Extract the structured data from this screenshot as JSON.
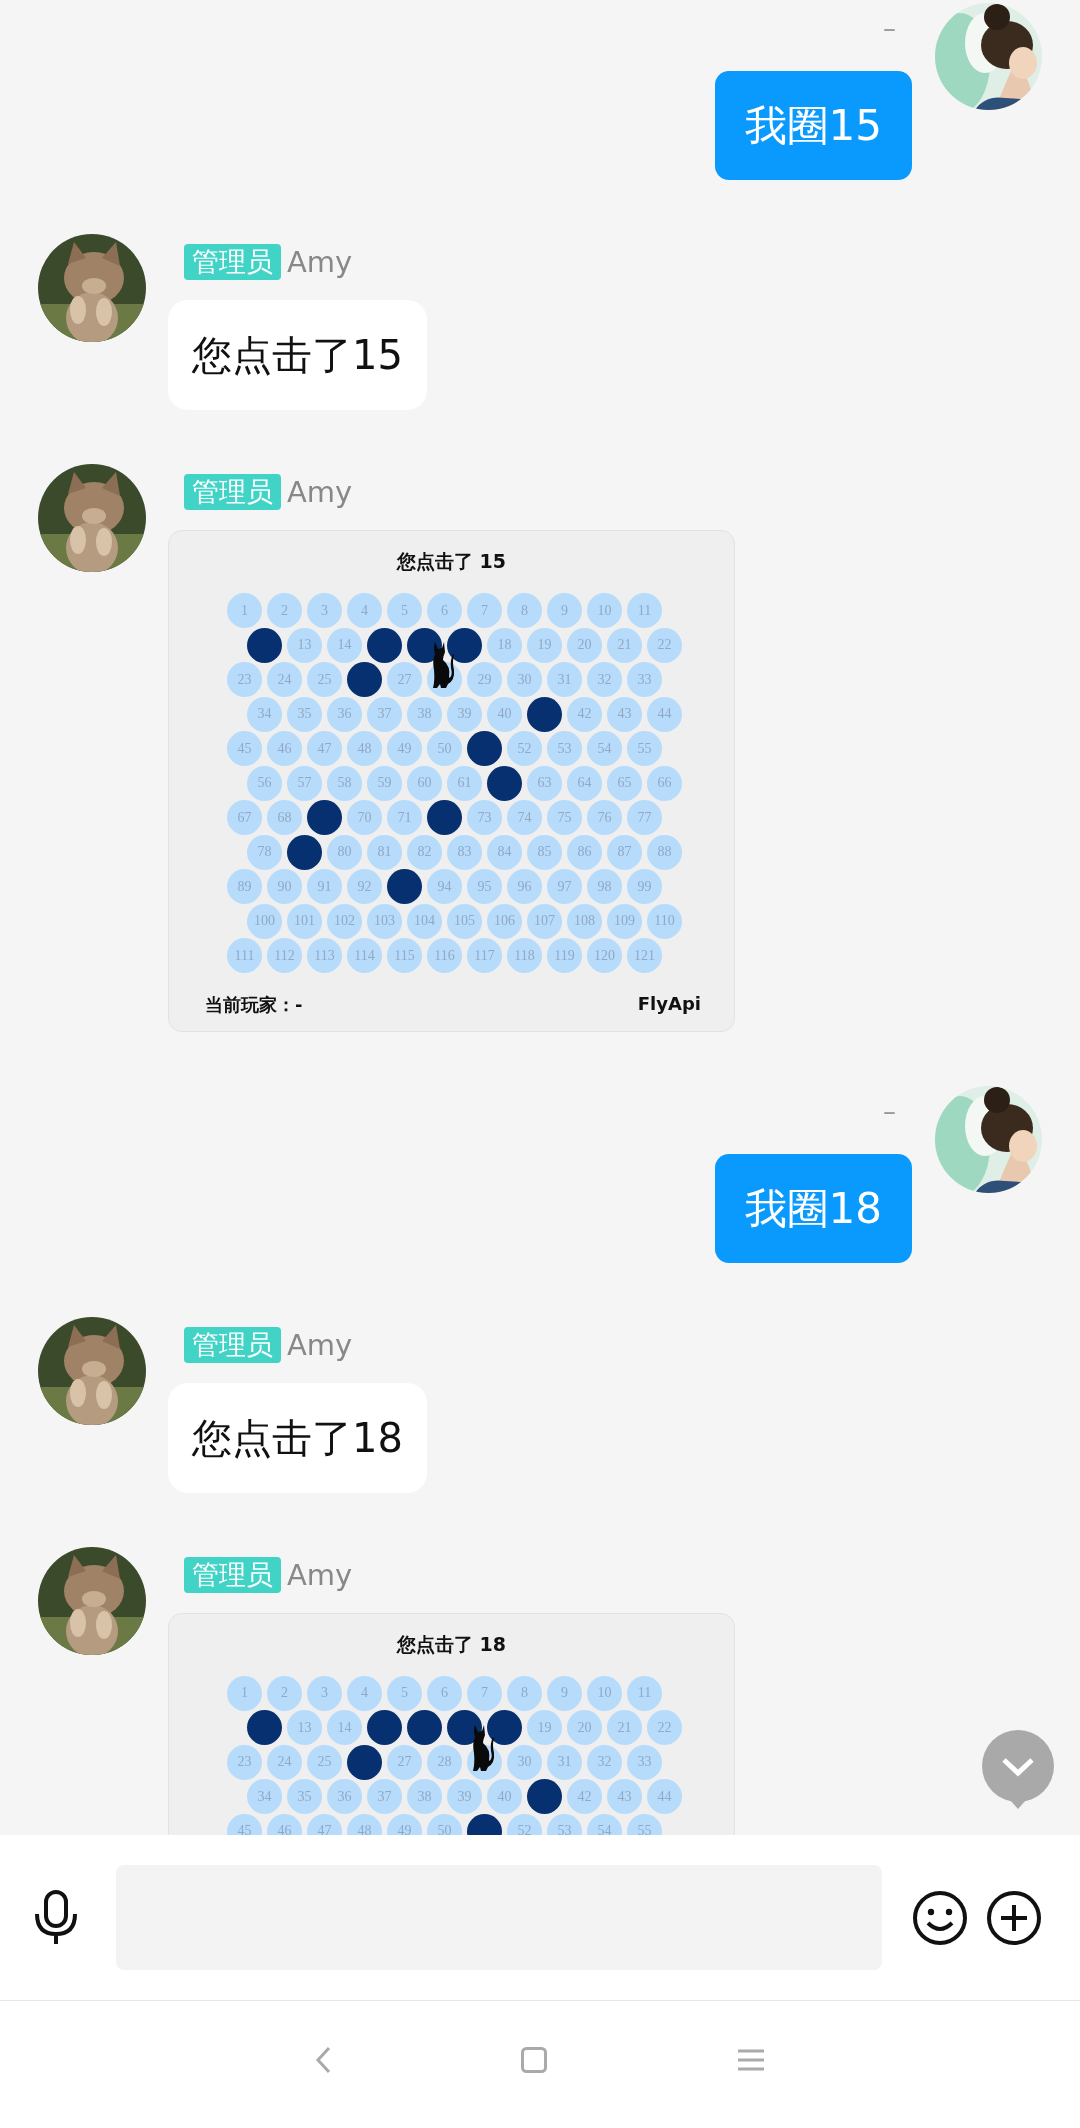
{
  "messages": [
    {
      "kind": "sent",
      "status": "–",
      "text": "我圈15"
    },
    {
      "kind": "text",
      "badge": "管理员",
      "sender": "Amy",
      "text": "您点击了15"
    },
    {
      "kind": "board",
      "badge": "管理员",
      "sender": "Amy",
      "board": {
        "title": "您点击了 15",
        "player": "当前玩家：-",
        "brand": "FlyApi",
        "cells": [
          {
            "label": "1",
            "blocked": false,
            "cat": false
          },
          {
            "label": "2",
            "blocked": false,
            "cat": false
          },
          {
            "label": "3",
            "blocked": false,
            "cat": false
          },
          {
            "label": "4",
            "blocked": false,
            "cat": false
          },
          {
            "label": "5",
            "blocked": false,
            "cat": false
          },
          {
            "label": "6",
            "blocked": false,
            "cat": false
          },
          {
            "label": "7",
            "blocked": false,
            "cat": false
          },
          {
            "label": "8",
            "blocked": false,
            "cat": false
          },
          {
            "label": "9",
            "blocked": false,
            "cat": false
          },
          {
            "label": "10",
            "blocked": false,
            "cat": false
          },
          {
            "label": "11",
            "blocked": false,
            "cat": false
          },
          {
            "blocked": true,
            "cat": false
          },
          {
            "label": "13",
            "blocked": false,
            "cat": false
          },
          {
            "label": "14",
            "blocked": false,
            "cat": false
          },
          {
            "blocked": true,
            "cat": false
          },
          {
            "blocked": true,
            "cat": false
          },
          {
            "blocked": true,
            "cat": false
          },
          {
            "label": "18",
            "blocked": false,
            "cat": false
          },
          {
            "label": "19",
            "blocked": false,
            "cat": false
          },
          {
            "label": "20",
            "blocked": false,
            "cat": false
          },
          {
            "label": "21",
            "blocked": false,
            "cat": false
          },
          {
            "label": "22",
            "blocked": false,
            "cat": false
          },
          {
            "label": "23",
            "blocked": false,
            "cat": false
          },
          {
            "label": "24",
            "blocked": false,
            "cat": false
          },
          {
            "label": "25",
            "blocked": false,
            "cat": false
          },
          {
            "blocked": true,
            "cat": false
          },
          {
            "label": "27",
            "blocked": false,
            "cat": false
          },
          {
            "blocked": false,
            "cat": true
          },
          {
            "label": "29",
            "blocked": false,
            "cat": false
          },
          {
            "label": "30",
            "blocked": false,
            "cat": false
          },
          {
            "label": "31",
            "blocked": false,
            "cat": false
          },
          {
            "label": "32",
            "blocked": false,
            "cat": false
          },
          {
            "label": "33",
            "blocked": false,
            "cat": false
          },
          {
            "label": "34",
            "blocked": false,
            "cat": false
          },
          {
            "label": "35",
            "blocked": false,
            "cat": false
          },
          {
            "label": "36",
            "blocked": false,
            "cat": false
          },
          {
            "label": "37",
            "blocked": false,
            "cat": false
          },
          {
            "label": "38",
            "blocked": false,
            "cat": false
          },
          {
            "label": "39",
            "blocked": false,
            "cat": false
          },
          {
            "label": "40",
            "blocked": false,
            "cat": false
          },
          {
            "blocked": true,
            "cat": false
          },
          {
            "label": "42",
            "blocked": false,
            "cat": false
          },
          {
            "label": "43",
            "blocked": false,
            "cat": false
          },
          {
            "label": "44",
            "blocked": false,
            "cat": false
          },
          {
            "label": "45",
            "blocked": false,
            "cat": false
          },
          {
            "label": "46",
            "blocked": false,
            "cat": false
          },
          {
            "label": "47",
            "blocked": false,
            "cat": false
          },
          {
            "label": "48",
            "blocked": false,
            "cat": false
          },
          {
            "label": "49",
            "blocked": false,
            "cat": false
          },
          {
            "label": "50",
            "blocked": false,
            "cat": false
          },
          {
            "blocked": true,
            "cat": false
          },
          {
            "label": "52",
            "blocked": false,
            "cat": false
          },
          {
            "label": "53",
            "blocked": false,
            "cat": false
          },
          {
            "label": "54",
            "blocked": false,
            "cat": false
          },
          {
            "label": "55",
            "blocked": false,
            "cat": false
          },
          {
            "label": "56",
            "blocked": false,
            "cat": false
          },
          {
            "label": "57",
            "blocked": false,
            "cat": false
          },
          {
            "label": "58",
            "blocked": false,
            "cat": false
          },
          {
            "label": "59",
            "blocked": false,
            "cat": false
          },
          {
            "label": "60",
            "blocked": false,
            "cat": false
          },
          {
            "label": "61",
            "blocked": false,
            "cat": false
          },
          {
            "blocked": true,
            "cat": false
          },
          {
            "label": "63",
            "blocked": false,
            "cat": false
          },
          {
            "label": "64",
            "blocked": false,
            "cat": false
          },
          {
            "label": "65",
            "blocked": false,
            "cat": false
          },
          {
            "label": "66",
            "blocked": false,
            "cat": false
          },
          {
            "label": "67",
            "blocked": false,
            "cat": false
          },
          {
            "label": "68",
            "blocked": false,
            "cat": false
          },
          {
            "blocked": true,
            "cat": false
          },
          {
            "label": "70",
            "blocked": false,
            "cat": false
          },
          {
            "label": "71",
            "blocked": false,
            "cat": false
          },
          {
            "blocked": true,
            "cat": false
          },
          {
            "label": "73",
            "blocked": false,
            "cat": false
          },
          {
            "label": "74",
            "blocked": false,
            "cat": false
          },
          {
            "label": "75",
            "blocked": false,
            "cat": false
          },
          {
            "label": "76",
            "blocked": false,
            "cat": false
          },
          {
            "label": "77",
            "blocked": false,
            "cat": false
          },
          {
            "label": "78",
            "blocked": false,
            "cat": false
          },
          {
            "blocked": true,
            "cat": false
          },
          {
            "label": "80",
            "blocked": false,
            "cat": false
          },
          {
            "label": "81",
            "blocked": false,
            "cat": false
          },
          {
            "label": "82",
            "blocked": false,
            "cat": false
          },
          {
            "label": "83",
            "blocked": false,
            "cat": false
          },
          {
            "label": "84",
            "blocked": false,
            "cat": false
          },
          {
            "label": "85",
            "blocked": false,
            "cat": false
          },
          {
            "label": "86",
            "blocked": false,
            "cat": false
          },
          {
            "label": "87",
            "blocked": false,
            "cat": false
          },
          {
            "label": "88",
            "blocked": false,
            "cat": false
          },
          {
            "label": "89",
            "blocked": false,
            "cat": false
          },
          {
            "label": "90",
            "blocked": false,
            "cat": false
          },
          {
            "label": "91",
            "blocked": false,
            "cat": false
          },
          {
            "label": "92",
            "blocked": false,
            "cat": false
          },
          {
            "blocked": true,
            "cat": false
          },
          {
            "label": "94",
            "blocked": false,
            "cat": false
          },
          {
            "label": "95",
            "blocked": false,
            "cat": false
          },
          {
            "label": "96",
            "blocked": false,
            "cat": false
          },
          {
            "label": "97",
            "blocked": false,
            "cat": false
          },
          {
            "label": "98",
            "blocked": false,
            "cat": false
          },
          {
            "label": "99",
            "blocked": false,
            "cat": false
          },
          {
            "label": "100",
            "blocked": false,
            "cat": false
          },
          {
            "label": "101",
            "blocked": false,
            "cat": false
          },
          {
            "label": "102",
            "blocked": false,
            "cat": false
          },
          {
            "label": "103",
            "blocked": false,
            "cat": false
          },
          {
            "label": "104",
            "blocked": false,
            "cat": false
          },
          {
            "label": "105",
            "blocked": false,
            "cat": false
          },
          {
            "label": "106",
            "blocked": false,
            "cat": false
          },
          {
            "label": "107",
            "blocked": false,
            "cat": false
          },
          {
            "label": "108",
            "blocked": false,
            "cat": false
          },
          {
            "label": "109",
            "blocked": false,
            "cat": false
          },
          {
            "label": "110",
            "blocked": false,
            "cat": false
          },
          {
            "label": "111",
            "blocked": false,
            "cat": false
          },
          {
            "label": "112",
            "blocked": false,
            "cat": false
          },
          {
            "label": "113",
            "blocked": false,
            "cat": false
          },
          {
            "label": "114",
            "blocked": false,
            "cat": false
          },
          {
            "label": "115",
            "blocked": false,
            "cat": false
          },
          {
            "label": "116",
            "blocked": false,
            "cat": false
          },
          {
            "label": "117",
            "blocked": false,
            "cat": false
          },
          {
            "label": "118",
            "blocked": false,
            "cat": false
          },
          {
            "label": "119",
            "blocked": false,
            "cat": false
          },
          {
            "label": "120",
            "blocked": false,
            "cat": false
          },
          {
            "label": "121",
            "blocked": false,
            "cat": false
          }
        ]
      }
    },
    {
      "kind": "sent",
      "status": "–",
      "text": "我圈18"
    },
    {
      "kind": "text",
      "badge": "管理员",
      "sender": "Amy",
      "text": "您点击了18"
    },
    {
      "kind": "board",
      "badge": "管理员",
      "sender": "Amy",
      "board": {
        "title": "您点击了 18",
        "cells": [
          {
            "label": "1",
            "blocked": false,
            "cat": false
          },
          {
            "label": "2",
            "blocked": false,
            "cat": false
          },
          {
            "label": "3",
            "blocked": false,
            "cat": false
          },
          {
            "label": "4",
            "blocked": false,
            "cat": false
          },
          {
            "label": "5",
            "blocked": false,
            "cat": false
          },
          {
            "label": "6",
            "blocked": false,
            "cat": false
          },
          {
            "label": "7",
            "blocked": false,
            "cat": false
          },
          {
            "label": "8",
            "blocked": false,
            "cat": false
          },
          {
            "label": "9",
            "blocked": false,
            "cat": false
          },
          {
            "label": "10",
            "blocked": false,
            "cat": false
          },
          {
            "label": "11",
            "blocked": false,
            "cat": false
          },
          {
            "blocked": true,
            "cat": false
          },
          {
            "label": "13",
            "blocked": false,
            "cat": false
          },
          {
            "label": "14",
            "blocked": false,
            "cat": false
          },
          {
            "blocked": true,
            "cat": false
          },
          {
            "blocked": true,
            "cat": false
          },
          {
            "blocked": true,
            "cat": false
          },
          {
            "blocked": true,
            "cat": false
          },
          {
            "label": "19",
            "blocked": false,
            "cat": false
          },
          {
            "label": "20",
            "blocked": false,
            "cat": false
          },
          {
            "label": "21",
            "blocked": false,
            "cat": false
          },
          {
            "label": "22",
            "blocked": false,
            "cat": false
          },
          {
            "label": "23",
            "blocked": false,
            "cat": false
          },
          {
            "label": "24",
            "blocked": false,
            "cat": false
          },
          {
            "label": "25",
            "blocked": false,
            "cat": false
          },
          {
            "blocked": true,
            "cat": false
          },
          {
            "label": "27",
            "blocked": false,
            "cat": false
          },
          {
            "label": "28",
            "blocked": false,
            "cat": false
          },
          {
            "blocked": false,
            "cat": true
          },
          {
            "label": "30",
            "blocked": false,
            "cat": false
          },
          {
            "label": "31",
            "blocked": false,
            "cat": false
          },
          {
            "label": "32",
            "blocked": false,
            "cat": false
          },
          {
            "label": "33",
            "blocked": false,
            "cat": false
          },
          {
            "label": "34",
            "blocked": false,
            "cat": false
          },
          {
            "label": "35",
            "blocked": false,
            "cat": false
          },
          {
            "label": "36",
            "blocked": false,
            "cat": false
          },
          {
            "label": "37",
            "blocked": false,
            "cat": false
          },
          {
            "label": "38",
            "blocked": false,
            "cat": false
          },
          {
            "label": "39",
            "blocked": false,
            "cat": false
          },
          {
            "label": "40",
            "blocked": false,
            "cat": false
          },
          {
            "blocked": true,
            "cat": false
          },
          {
            "label": "42",
            "blocked": false,
            "cat": false
          },
          {
            "label": "43",
            "blocked": false,
            "cat": false
          },
          {
            "label": "44",
            "blocked": false,
            "cat": false
          },
          {
            "label": "45",
            "blocked": false,
            "cat": false
          },
          {
            "label": "46",
            "blocked": false,
            "cat": false
          },
          {
            "label": "47",
            "blocked": false,
            "cat": false
          },
          {
            "label": "48",
            "blocked": false,
            "cat": false
          },
          {
            "label": "49",
            "blocked": false,
            "cat": false
          },
          {
            "label": "50",
            "blocked": false,
            "cat": false
          },
          {
            "blocked": true,
            "cat": false
          },
          {
            "label": "52",
            "blocked": false,
            "cat": false
          },
          {
            "label": "53",
            "blocked": false,
            "cat": false
          },
          {
            "label": "54",
            "blocked": false,
            "cat": false
          },
          {
            "label": "55",
            "blocked": false,
            "cat": false
          }
        ]
      }
    }
  ]
}
